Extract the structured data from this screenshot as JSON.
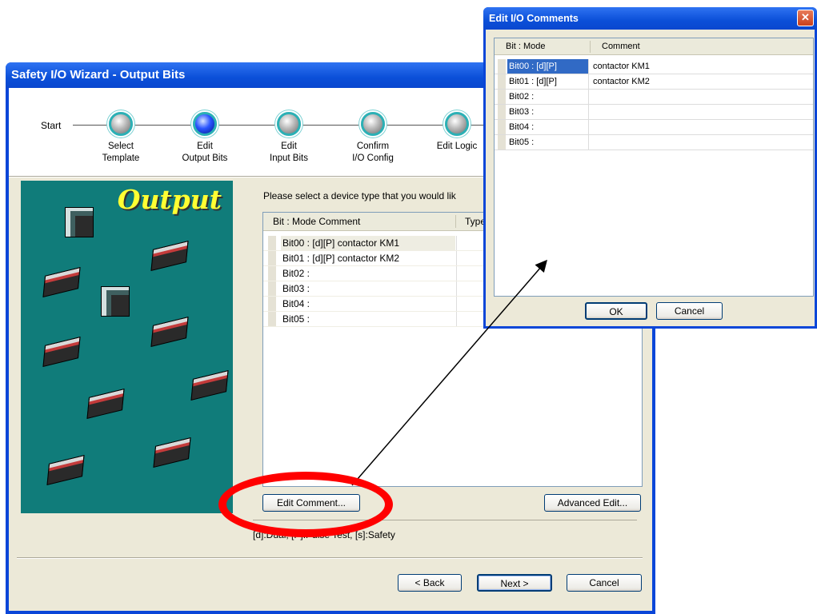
{
  "wizard": {
    "title": "Safety I/O Wizard - Output Bits",
    "start_label": "Start",
    "steps": [
      {
        "label": "Select\nTemplate",
        "active": false
      },
      {
        "label": "Edit\nOutput Bits",
        "active": true
      },
      {
        "label": "Edit\nInput Bits",
        "active": false
      },
      {
        "label": "Confirm\nI/O Config",
        "active": false
      },
      {
        "label": "Edit Logic",
        "active": false
      }
    ],
    "image_title": "Output",
    "instruction": "Please select a device type that you would lik",
    "list": {
      "col_bit_mode_comment": "Bit : Mode Comment",
      "col_type": "Type",
      "rows": [
        "Bit00 : [d][P] contactor KM1",
        "Bit01 : [d][P] contactor KM2",
        "Bit02 :",
        "Bit03 :",
        "Bit04 :",
        "Bit05 :"
      ]
    },
    "edit_comment_button": "Edit Comment...",
    "advanced_edit_button": "Advanced Edit...",
    "legend": "[d]:Dual, [P]:Pulse Test, [s]:Safety",
    "back_button": "< Back",
    "next_button": "Next >",
    "cancel_button": "Cancel"
  },
  "dialog": {
    "title": "Edit I/O Comments",
    "close_glyph": "✕",
    "col_bit_mode": "Bit : Mode",
    "col_comment": "Comment",
    "rows": [
      {
        "bit_mode": "Bit00 : [d][P]",
        "comment": "contactor KM1"
      },
      {
        "bit_mode": "Bit01 : [d][P]",
        "comment": "contactor KM2"
      },
      {
        "bit_mode": "Bit02 :",
        "comment": ""
      },
      {
        "bit_mode": "Bit03 :",
        "comment": ""
      },
      {
        "bit_mode": "Bit04 :",
        "comment": ""
      },
      {
        "bit_mode": "Bit05 :",
        "comment": ""
      }
    ],
    "ok_button": "OK",
    "cancel_button": "Cancel"
  },
  "colors": {
    "title_bar": "#0b4fd8",
    "teal_panel": "#107c7a",
    "output_title": "#ffff33",
    "highlight_ellipse": "#ff0000",
    "selection": "#316ac5"
  }
}
